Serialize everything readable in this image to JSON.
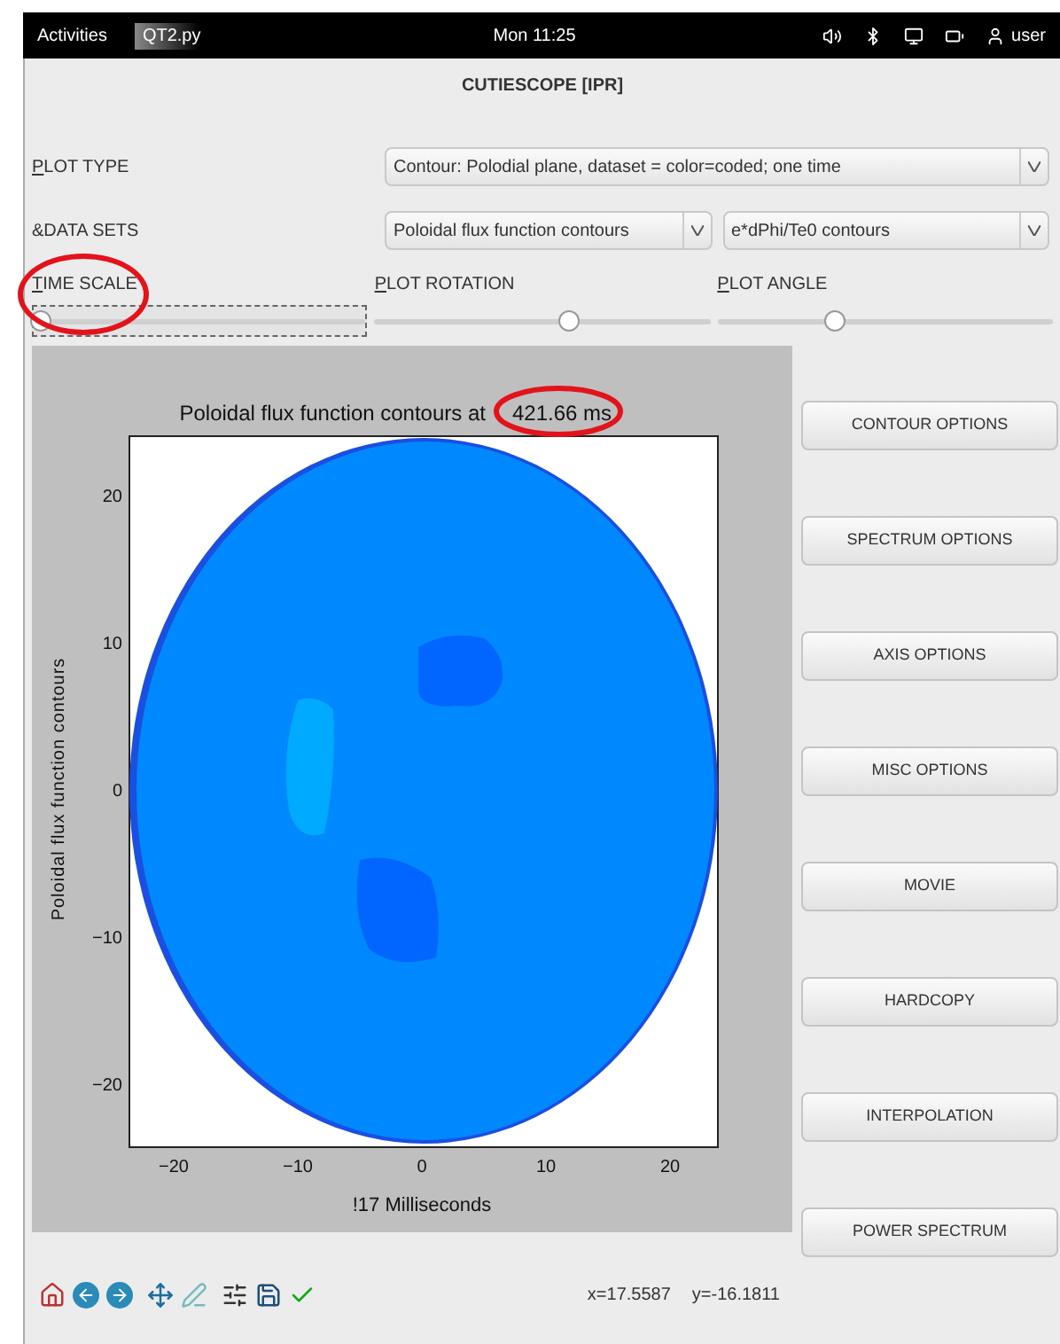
{
  "top_bar": {
    "activities": "Activities",
    "app": "QT2.py",
    "clock": "Mon 11:25",
    "user": "user"
  },
  "window": {
    "title": "CUTIESCOPE [IPR]"
  },
  "plot_type": {
    "label": "PLOT TYPE",
    "value": "Contour: Polodial plane, dataset = color=coded; one time"
  },
  "data_sets": {
    "label": "&DATA SETS",
    "values": [
      "Poloidal flux function contours",
      "e*dPhi/Te0 contours"
    ]
  },
  "sliders": [
    {
      "label": "TIME SCALE",
      "level": 0.02,
      "circled": true,
      "framed": true
    },
    {
      "label": "PLOT ROTATION",
      "level": 0.58,
      "circled": false,
      "framed": false
    },
    {
      "label": "PLOT ANGLE",
      "level": 0.35,
      "circled": false,
      "framed": false
    }
  ],
  "plot": {
    "title": "Poloidal flux function contours at",
    "time": "421.66 ms",
    "time_circled": true,
    "ylabel": "Poloidal flux function contours",
    "xlabel": "!17 Milliseconds",
    "xticks": [
      "−20",
      "−10",
      "0",
      "10",
      "20"
    ],
    "yticks": [
      "20",
      "10",
      "0",
      "−10",
      "−20"
    ]
  },
  "buttons": [
    "CONTOUR OPTIONS",
    "SPECTRUM OPTIONS",
    "AXIS OPTIONS",
    "MISC OPTIONS",
    "MOVIE",
    "HARDCOPY",
    "INTERPOLATION",
    "POWER SPECTRUM"
  ],
  "status": {
    "x": "x=17.5587",
    "y": "y=-16.1811"
  }
}
